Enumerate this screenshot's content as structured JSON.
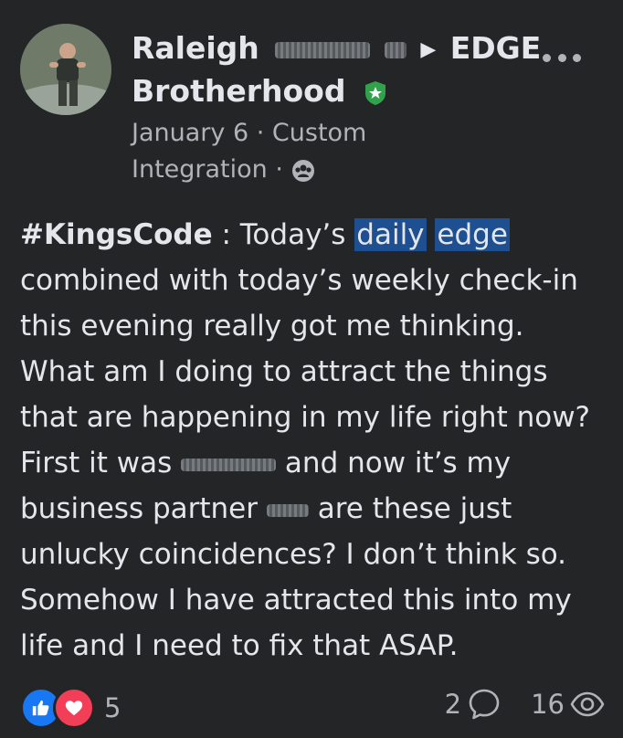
{
  "post": {
    "author_first": "Raleigh",
    "group_name_1": "EDGE",
    "group_name_2": "Brotherhood",
    "date": "January 6",
    "sep": "·",
    "app": "Custom",
    "app2": "Integration",
    "body": {
      "hashtag": "#KingsCode",
      "seg1": " : Today’s ",
      "hl1": "daily",
      "hl2": "edge",
      "seg2": " combined with today’s weekly check-in this evening really got me thinking. What am I doing to attract the things that are happening in my life right now? First it was ",
      "seg3": " and now it’s my business partner ",
      "seg4": " are these just unlucky coincidences? I don’t think so. Somehow I have attracted this into my life and I need to fix that ASAP."
    }
  },
  "footer": {
    "reaction_count": "5",
    "comment_count": "2",
    "view_count": "16"
  },
  "icons": {
    "more": "more-options-icon",
    "badge": "shield-badge-icon",
    "audience": "group-audience-icon",
    "like": "like-icon",
    "love": "love-icon",
    "comment": "comment-icon",
    "views": "eye-icon"
  },
  "colors": {
    "background": "#242526",
    "text": "#e4e6eb",
    "muted": "#b0b3b8",
    "highlight": "#1d4f91",
    "like": "#1877f2",
    "love": "#f33e58",
    "badge": "#31a24c"
  }
}
